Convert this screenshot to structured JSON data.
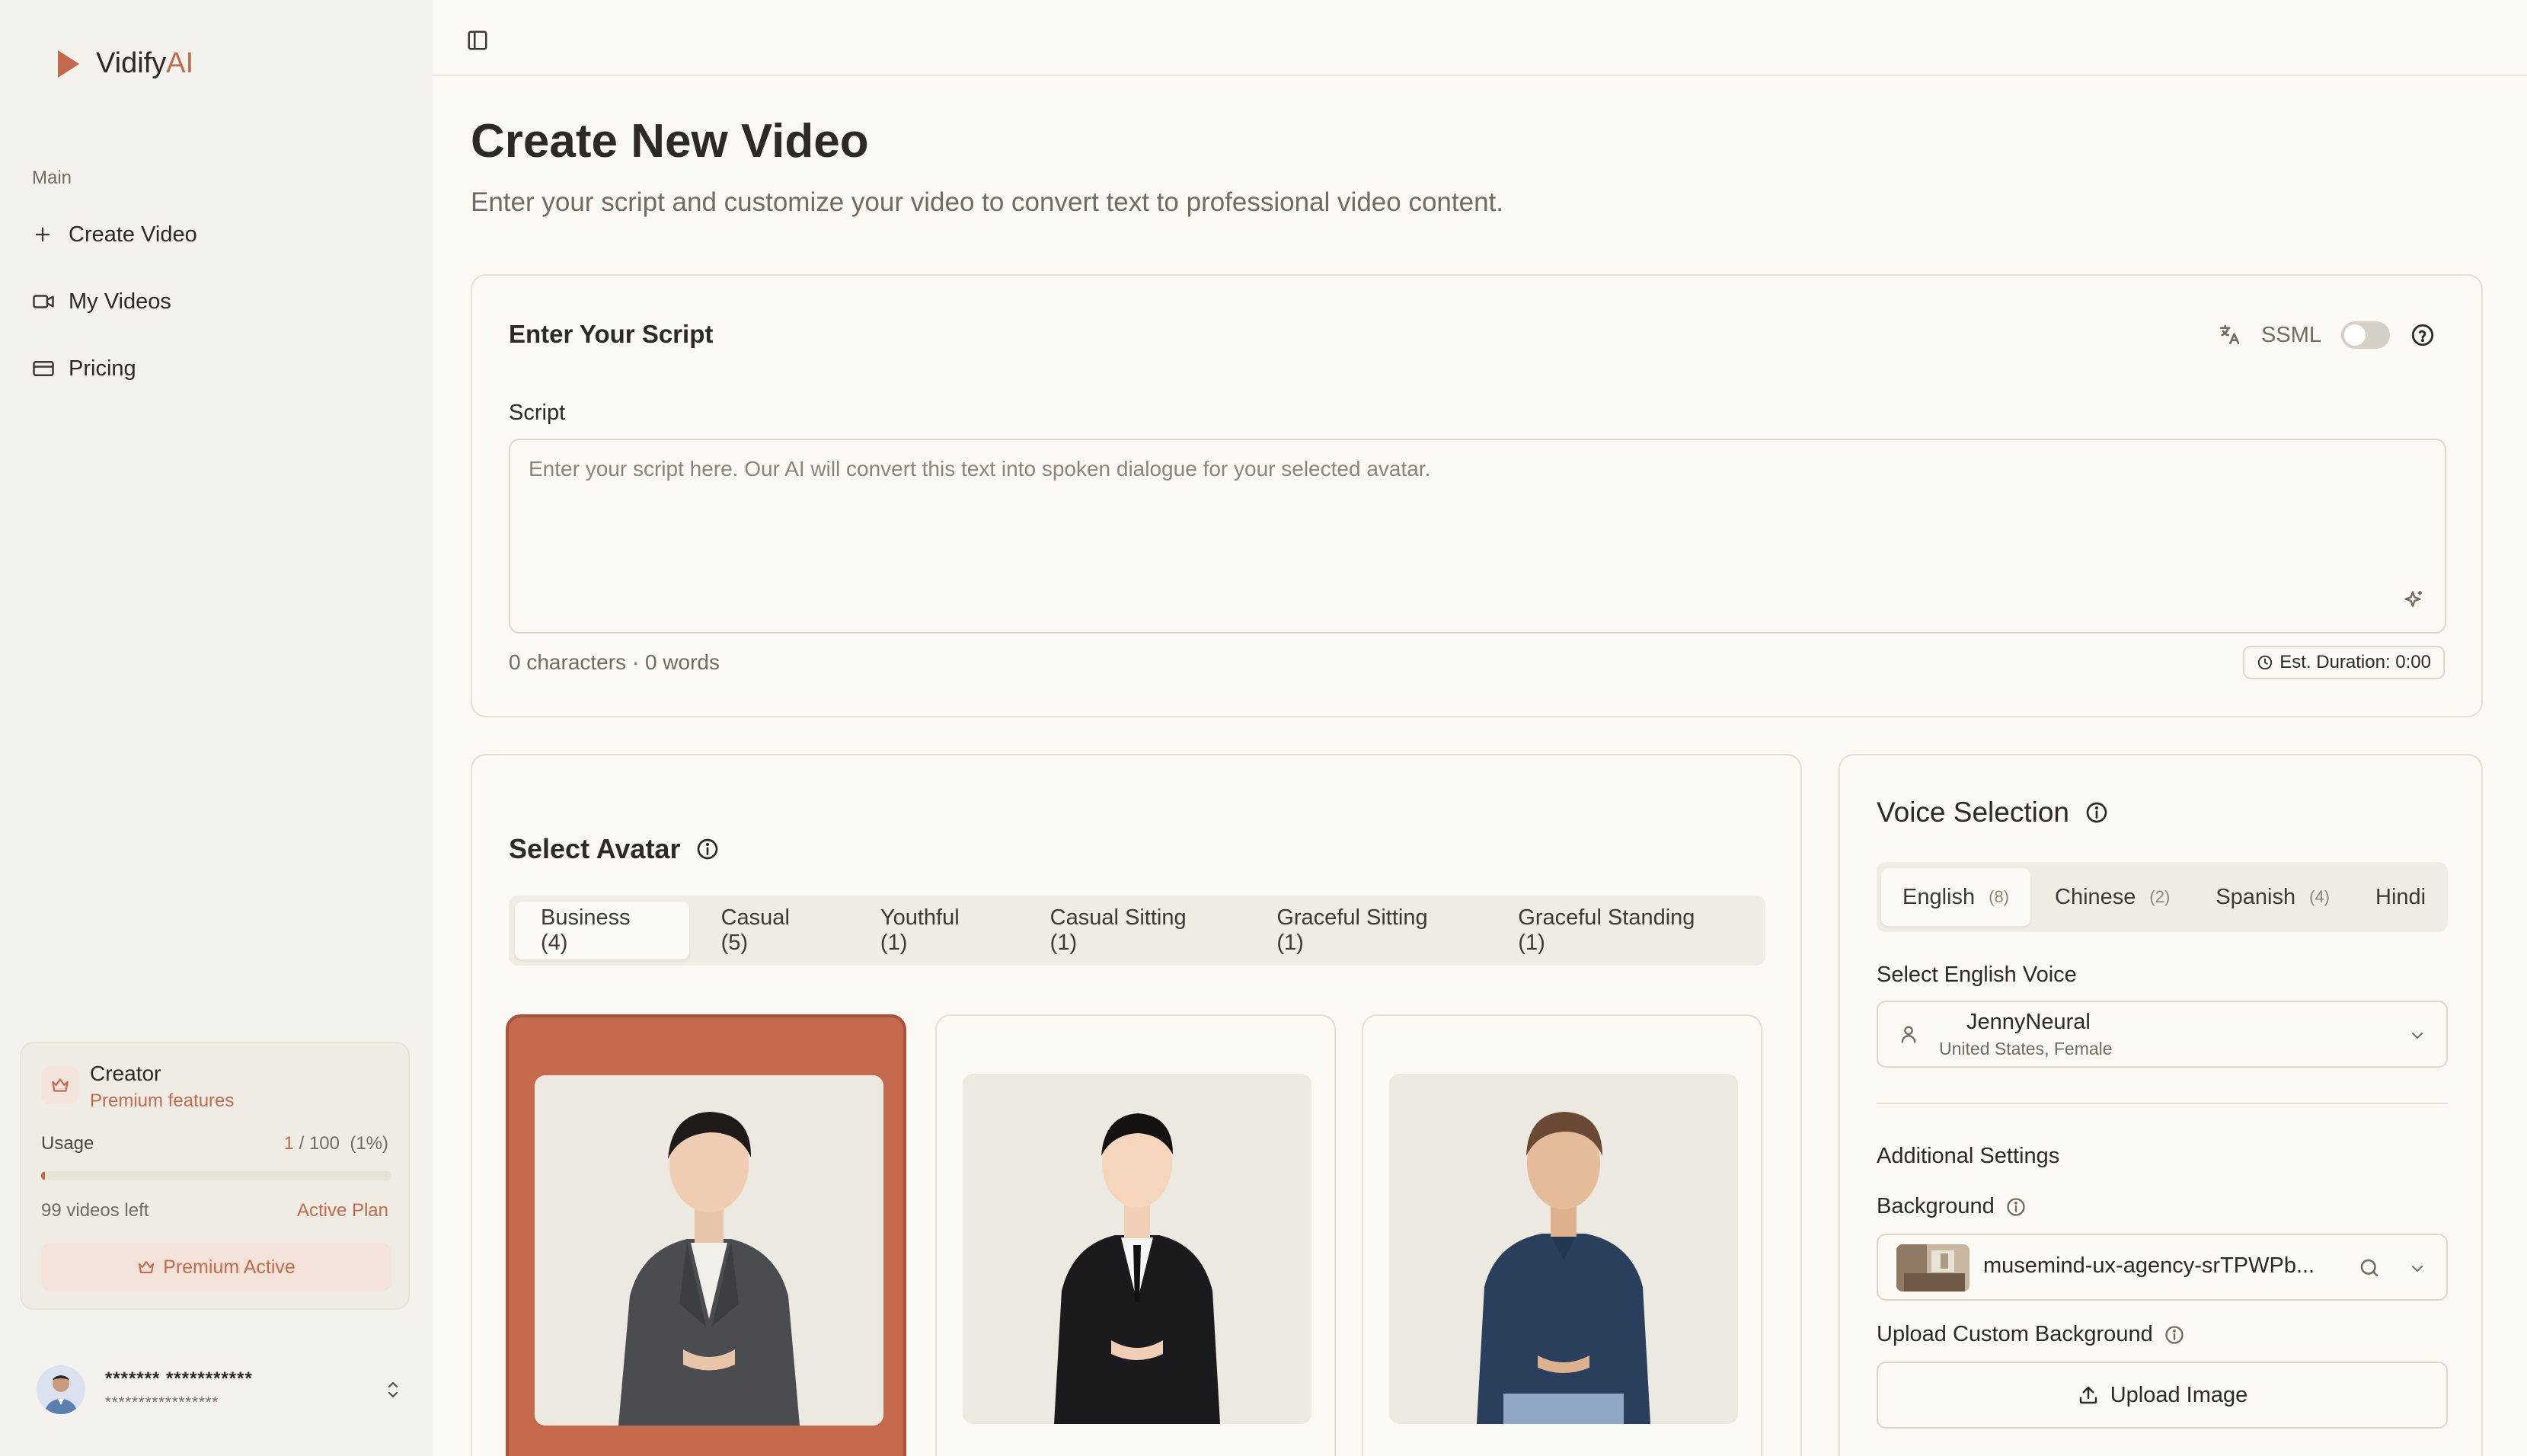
{
  "app": {
    "name_main": "Vidify",
    "name_accent": "AI"
  },
  "sidebar": {
    "section": "Main",
    "items": [
      {
        "label": "Create Video",
        "icon": "plus-icon"
      },
      {
        "label": "My Videos",
        "icon": "video-icon"
      },
      {
        "label": "Pricing",
        "icon": "credit-card-icon"
      }
    ],
    "plan_card": {
      "title": "Creator",
      "subtitle": "Premium features",
      "usage_label": "Usage",
      "usage_used": "1",
      "usage_total": " / 100",
      "usage_pct": "(1%)",
      "usage_fraction": 0.01,
      "videos_left": "99 videos left",
      "plan_status": "Active Plan",
      "button": "Premium Active"
    },
    "user": {
      "name": "******* ***********",
      "email": "*****************"
    }
  },
  "main": {
    "title": "Create New Video",
    "subtitle": "Enter your script and customize your video to convert text to professional video content.",
    "script_card": {
      "title": "Enter Your Script",
      "ssml_label": "SSML",
      "field_label": "Script",
      "placeholder": "Enter your script here. Our AI will convert this text into spoken dialogue for your selected avatar.",
      "counts": "0 characters · 0 words",
      "duration": "Est. Duration: 0:00"
    },
    "avatar_card": {
      "title": "Select Avatar",
      "tabs": [
        "Business (4)",
        "Casual (5)",
        "Youthful (1)",
        "Casual Sitting (1)",
        "Graceful Sitting (1)",
        "Graceful Standing (1)"
      ]
    },
    "voice_card": {
      "title": "Voice Selection",
      "tabs": [
        {
          "label": "English",
          "count": "(8)"
        },
        {
          "label": "Chinese",
          "count": "(2)"
        },
        {
          "label": "Spanish",
          "count": "(4)"
        },
        {
          "label": "Hindi",
          "count": ""
        }
      ],
      "voice_label": "Select English Voice",
      "voice_name": "JennyNeural",
      "voice_detail": "United States, Female",
      "additional_settings": "Additional Settings",
      "background_label": "Background",
      "background_value": "musemind-ux-agency-srTPWPb...",
      "upload_label": "Upload Custom Background",
      "upload_button": "Upload Image"
    }
  }
}
